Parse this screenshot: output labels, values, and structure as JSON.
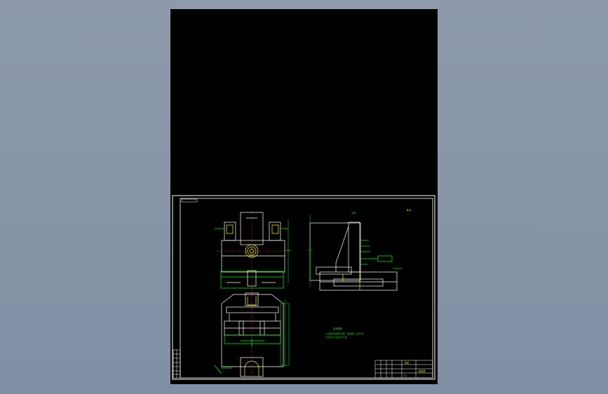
{
  "viewer": {
    "background_color": "#8795a8",
    "sheet_color": "#000000"
  },
  "drawing": {
    "line_colors": {
      "outline": "#ffffff",
      "part": "#00ff00",
      "dimension": "#00ffff",
      "accent": "#ffff00",
      "center": "#ff0000"
    },
    "view_label": "A-A",
    "section_label": "B-B",
    "notes_heading": "技术要求",
    "notes": [
      "1. 装配前所有零件去毛刺、锐边倒钝、清洗干净。",
      "2. 未注尺寸公差按 IT12 级。"
    ],
    "title_block": {
      "part_name": "夹具",
      "drawing_no": "夹具体",
      "scale": "1:1"
    }
  }
}
